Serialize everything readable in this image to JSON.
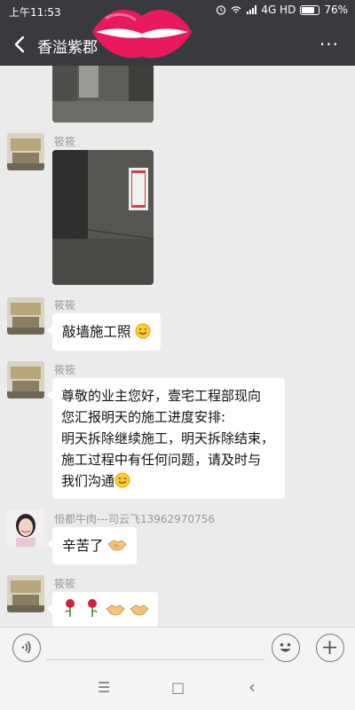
{
  "status": {
    "time": "上午11:53",
    "network": "4G HD",
    "battery": "76%"
  },
  "header": {
    "title": "香溢紫郡",
    "more": "···"
  },
  "messages": [
    {
      "sender": "筱筱",
      "type": "text",
      "text": "敲墙施工照"
    },
    {
      "sender": "筱筱",
      "type": "text",
      "lines": [
        "尊敬的业主您好，壹宅工程部现向",
        "您汇报明天的施工进度安排:",
        "明天拆除继续施工，明天拆除结束，",
        "施工过程中有任何问题，请及时与",
        "我们沟通"
      ]
    },
    {
      "sender": "恒都牛肉---司云飞13962970756",
      "type": "text",
      "text": "辛苦了"
    },
    {
      "sender": "筱筱",
      "type": "emoji",
      "text": "🌹🌹🤝🤝"
    }
  ],
  "nicknames": {
    "n1": "筱筱",
    "n2": "筱筱",
    "n3": "筱筱",
    "n4": "恒都牛肉---司云飞13962970756",
    "n5": "筱筱"
  },
  "icons": {
    "back": "back-arrow-icon",
    "voice": "voice-icon",
    "emoji": "emoji-icon",
    "add": "plus-icon"
  },
  "nav": {
    "menu": "☰",
    "home": "□",
    "back": "‹"
  }
}
